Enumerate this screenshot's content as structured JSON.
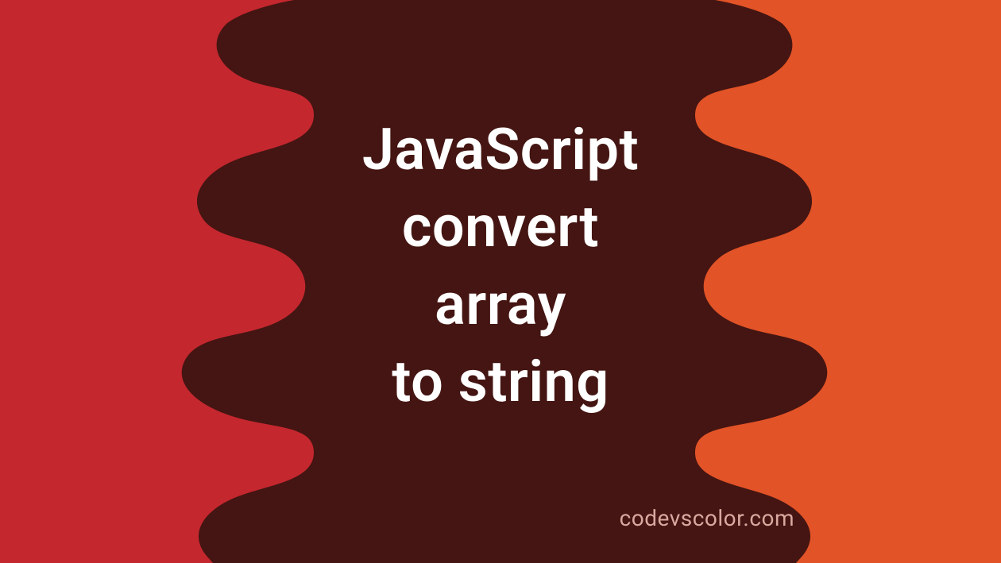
{
  "colors": {
    "bg_left": "#c5272f",
    "bg_right": "#e25327",
    "blob": "#441512",
    "text": "#ffffff",
    "footer": "#d9a8a0"
  },
  "title_lines": "JavaScript\nconvert\narray\nto string",
  "footer_text": "codevscolor.com"
}
